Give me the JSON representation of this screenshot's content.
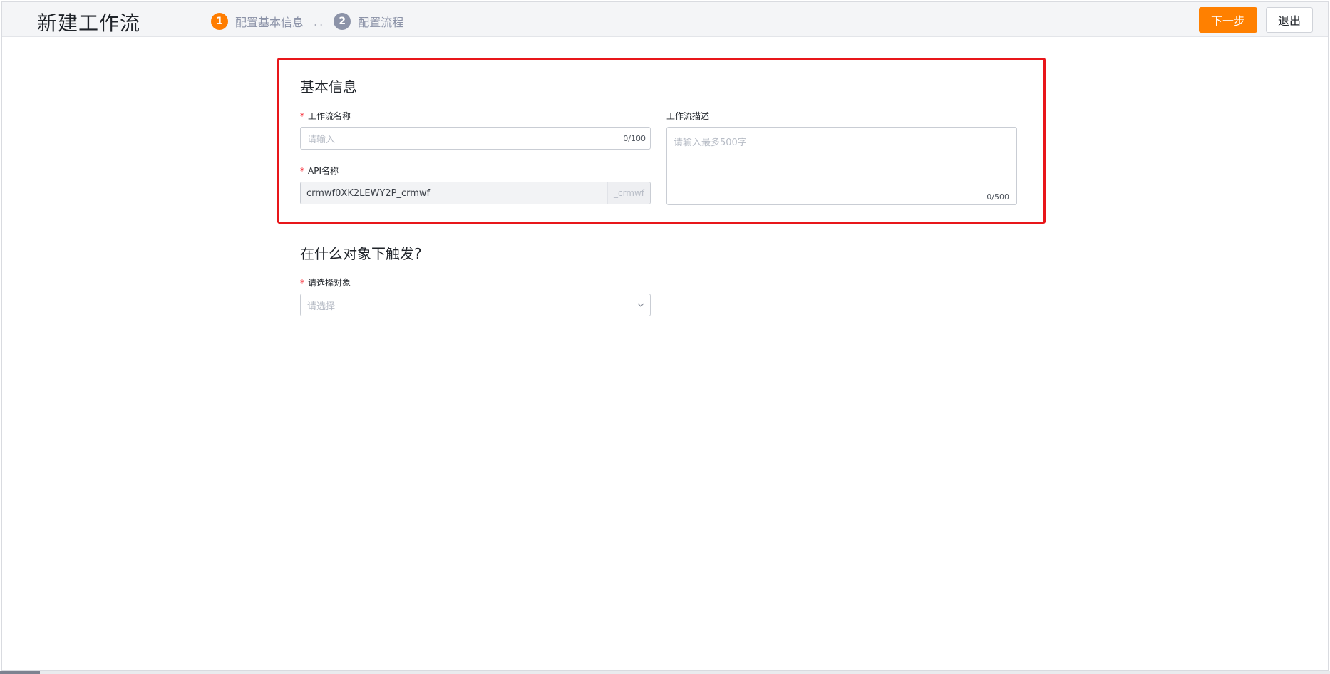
{
  "header": {
    "title": "新建工作流",
    "steps": [
      {
        "number": "1",
        "label": "配置基本信息",
        "state": "active"
      },
      {
        "number": "2",
        "label": "配置流程",
        "state": "inactive"
      }
    ],
    "step_separator": "..",
    "next_button": "下一步",
    "exit_button": "退出"
  },
  "basic_info": {
    "section_title": "基本信息",
    "required_mark": "*",
    "workflow_name": {
      "label": "工作流名称",
      "placeholder": "请输入",
      "counter": "0/100"
    },
    "api_name": {
      "label": "API名称",
      "value": "crmwf0XK2LEWY2P_crmwf",
      "suffix": "_crmwf"
    },
    "description": {
      "label": "工作流描述",
      "placeholder": "请输入最多500字",
      "counter": "0/500"
    }
  },
  "trigger": {
    "section_title": "在什么对象下触发?",
    "required_mark": "*",
    "object": {
      "label": "请选择对象",
      "placeholder": "请选择"
    }
  },
  "colors": {
    "accent": "#ff8000",
    "step_active": "#ff7d00",
    "step_inactive": "#8c93a8",
    "highlight_border": "#e8161a",
    "required": "#f5222d"
  }
}
